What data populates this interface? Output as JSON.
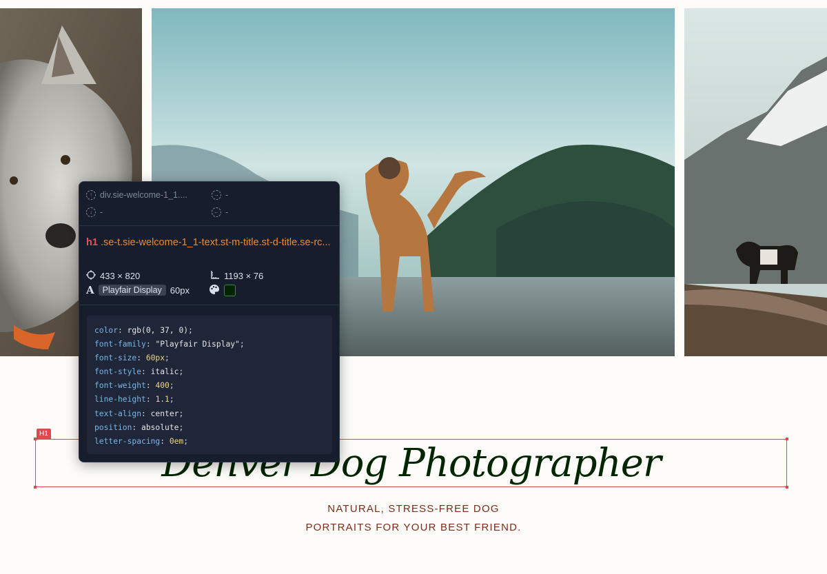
{
  "page": {
    "title": "Denver Dog Photographer",
    "subtitle_line1": "NATURAL, STRESS-FREE DOG",
    "subtitle_line2": "PORTRAITS FOR YOUR BEST FRIEND."
  },
  "photos": [
    {
      "name": "white dog close-up"
    },
    {
      "name": "brown dog on gravel before mountains"
    },
    {
      "name": "black and white dog on mountain ledge"
    }
  ],
  "selection": {
    "tag_label": "H1"
  },
  "inspector": {
    "parent_label": "div.sie-welcome-1_1....",
    "nav_placeholder": "-",
    "element_tag": "h1",
    "element_selector": ".se-t.sie-welcome-1_1-text.st-m-title.st-d-title.se-rc...",
    "position": "433 × 820",
    "size": "1193 × 76",
    "font_name": "Playfair Display",
    "font_size": "60px",
    "color_swatch": "#002500",
    "css": [
      {
        "prop": "color",
        "value": "rgb(0, 37, 0)"
      },
      {
        "prop": "font-family",
        "value": "\"Playfair Display\""
      },
      {
        "prop": "font-size",
        "value": "60px"
      },
      {
        "prop": "font-style",
        "value": "italic"
      },
      {
        "prop": "font-weight",
        "value": "400"
      },
      {
        "prop": "line-height",
        "value": "1.1"
      },
      {
        "prop": "text-align",
        "value": "center"
      },
      {
        "prop": "position",
        "value": "absolute"
      },
      {
        "prop": "letter-spacing",
        "value": "0em"
      }
    ]
  },
  "colors": {
    "heading": "#002500",
    "subtitle": "#7a2c1c",
    "highlight": "#e2474f",
    "selector": "#f08a2a"
  }
}
